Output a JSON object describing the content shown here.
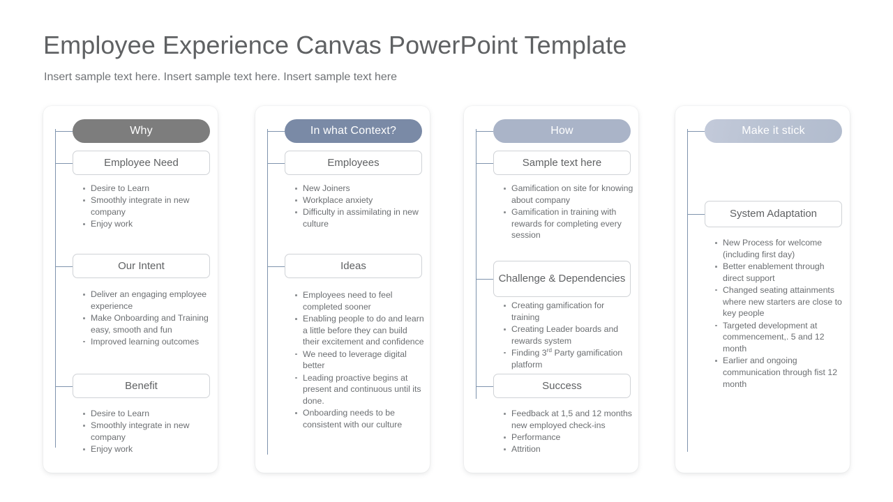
{
  "header": {
    "title": "Employee Experience Canvas PowerPoint Template",
    "subtitle": "Insert sample text here. Insert sample text here. Insert sample text here"
  },
  "colors": {
    "pill_why": "#7d7d7d",
    "pill_context": "#7a8aa6",
    "pill_how": "#aab4c8",
    "pill_stick": "#b9c2d2",
    "connector": "#7e93ad",
    "title_text": "#5f6163",
    "body_text": "#6b6e71",
    "box_border": "#cfd2d6",
    "card_background": "#ffffff"
  },
  "columns": [
    {
      "pill_label": "Why",
      "pill_color": "#7d7d7d",
      "sections": [
        {
          "title": "Employee Need",
          "bullets": [
            "Desire to Learn",
            "Smoothly integrate in new company",
            "Enjoy work"
          ]
        },
        {
          "title": "Our Intent",
          "bullets": [
            "Deliver an engaging employee experience",
            "Make Onboarding and Training easy, smooth and fun",
            "Improved learning outcomes"
          ]
        },
        {
          "title": "Benefit",
          "bullets": [
            "Desire to Learn",
            "Smoothly integrate in new company",
            "Enjoy work"
          ]
        }
      ]
    },
    {
      "pill_label": "In what Context?",
      "pill_color": "#7a8aa6",
      "sections": [
        {
          "title": "Employees",
          "bullets": [
            "New Joiners",
            "Workplace anxiety",
            "Difficulty in assimilating in new culture"
          ]
        },
        {
          "title": "Ideas",
          "bullets": [
            "Employees need to feel completed sooner",
            "Enabling people to do and learn a little before they can build their excitement and confidence",
            "We need to leverage digital better",
            "Leading proactive begins at present and continuous until its done.",
            "Onboarding needs to be consistent with our culture"
          ]
        }
      ]
    },
    {
      "pill_label": "How",
      "pill_color": "#aab4c8",
      "sections": [
        {
          "title": "Sample text here",
          "bullets": [
            "Gamification on site for knowing about company",
            "Gamification in training with rewards for completing every session"
          ]
        },
        {
          "title": "Challenge & Dependencies",
          "bullets": [
            "Creating gamification for training",
            "Creating Leader boards and rewards system",
            "Finding 3<sup>rd</sup> Party gamification platform"
          ]
        },
        {
          "title": "Success",
          "bullets": [
            "Feedback at 1,5 and 12 months new employed check-ins",
            "Performance",
            "Attrition"
          ]
        }
      ]
    },
    {
      "pill_label": "Make it stick",
      "pill_color": "#b9c2d2",
      "sections": [
        {
          "title": "System Adaptation",
          "bullets": [
            "New Process for welcome (including first day)",
            "Better enablement through direct support",
            "Changed seating attainments where new starters are close to key people",
            "Targeted development at commencement,. 5 and 12 month",
            "Earlier and ongoing communication through fist 12 month"
          ]
        }
      ]
    }
  ]
}
